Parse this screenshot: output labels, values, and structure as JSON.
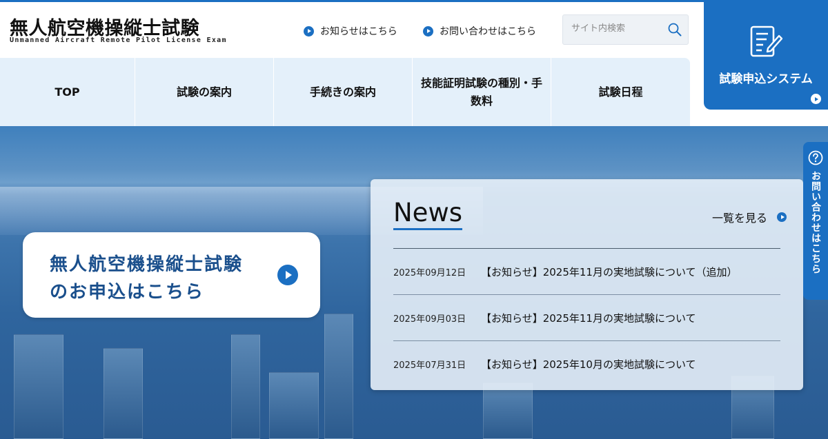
{
  "header": {
    "logo_jp": "無人航空機操縦士試験",
    "logo_en": "Unmanned Aircraft Remote Pilot License Exam",
    "links": [
      "お知らせはこちら",
      "お問い合わせはこちら"
    ],
    "search_placeholder": "サイト内検索"
  },
  "apply_system": {
    "label": "試験申込システム"
  },
  "nav": {
    "items": [
      "TOP",
      "試験の案内",
      "手続きの案内",
      "技能証明試験の種別・手数料",
      "試験日程"
    ]
  },
  "hero": {
    "cta_line1": "無人航空機操縦士試験",
    "cta_line2": "のお申込はこちら"
  },
  "news": {
    "title": "News",
    "more_label": "一覧を見る",
    "items": [
      {
        "date": "2025年09月12日",
        "text": "【お知らせ】2025年11月の実地試験について（追加）"
      },
      {
        "date": "2025年09月03日",
        "text": "【お知らせ】2025年11月の実地試験について"
      },
      {
        "date": "2025年07月31日",
        "text": "【お知らせ】2025年10月の実地試験について"
      }
    ]
  },
  "side_tab": {
    "label": "お問い合わせはこちら"
  },
  "colors": {
    "accent": "#1b6fc2",
    "nav_bg": "#e4f0fa"
  },
  "icons": {
    "search": "search-icon",
    "document": "document-pen-icon",
    "question": "question-icon",
    "play": "play-icon"
  }
}
